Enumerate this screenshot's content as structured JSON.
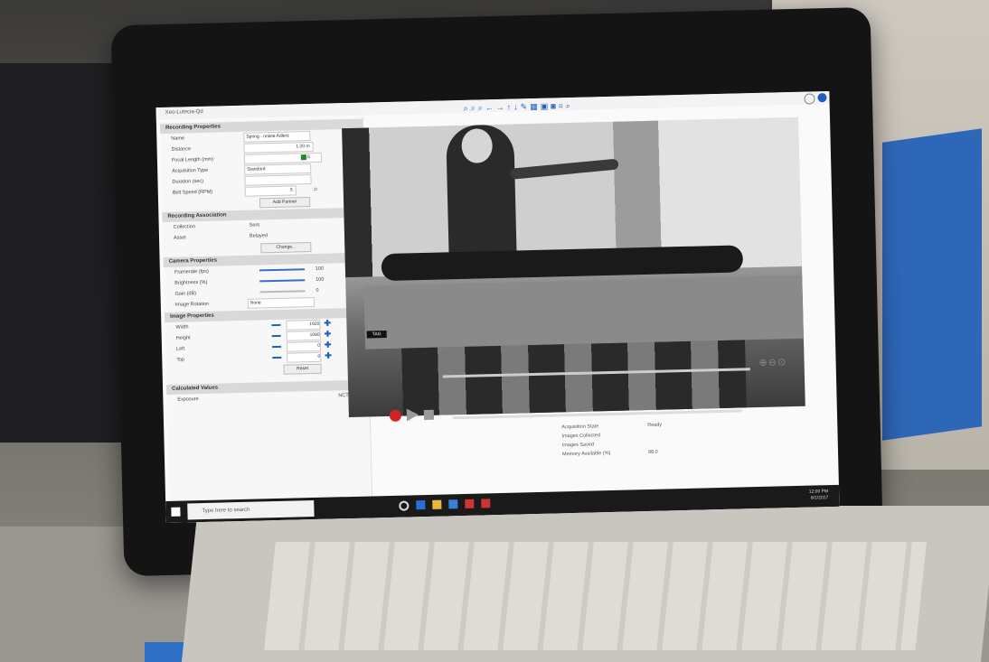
{
  "window": {
    "title": "Xeo-Lutecia-Qd"
  },
  "toolbar_icons": [
    "zoom-in-icon",
    "zoom-out-icon",
    "zoom-fit-icon",
    "arrow-left-icon",
    "arrow-right-icon",
    "arrow-up-icon",
    "arrow-down-icon",
    "pencil-icon",
    "grid-icon",
    "lock-icon",
    "camera-icon",
    "crop-icon",
    "search-icon"
  ],
  "recording_properties": {
    "header": "Recording Properties",
    "rows": [
      {
        "label": "Name",
        "value": "Spring - onsite Adlerz"
      },
      {
        "label": "Distance",
        "value": "1.20  m"
      },
      {
        "label": "Focal Length (mm)",
        "value": "12.5"
      },
      {
        "label": "Acquisition Type",
        "value": "Standard"
      },
      {
        "label": "Duration (sec)",
        "value": ""
      },
      {
        "label": "Belt Speed (RPM)",
        "value": "5"
      }
    ],
    "button": "Add Partner"
  },
  "recording_association": {
    "header": "Recording Association",
    "rows": [
      {
        "label": "Collection",
        "value": "Sent"
      },
      {
        "label": "Asset",
        "value": "Belayed"
      }
    ],
    "button": "Change..."
  },
  "camera_properties": {
    "header": "Camera Properties",
    "rows": [
      {
        "label": "Framerate (fps)",
        "value": "100"
      },
      {
        "label": "Brightness (%)",
        "value": "100"
      },
      {
        "label": "Gain (dB)",
        "value": "0"
      },
      {
        "label": "Image Rotation",
        "value": "None"
      }
    ]
  },
  "image_properties": {
    "header": "Image Properties",
    "rows": [
      {
        "label": "Width",
        "value": "1920"
      },
      {
        "label": "Height",
        "value": "1080"
      },
      {
        "label": "Left",
        "value": "0"
      },
      {
        "label": "Top",
        "value": "0"
      }
    ],
    "reset_label": "Reset"
  },
  "calculated_values": {
    "header": "Calculated Values",
    "rows": [
      {
        "label": "Exposure",
        "value": "NCT"
      }
    ]
  },
  "video": {
    "overlay_tag": "TAG"
  },
  "stats": [
    {
      "label": "Acquisition State",
      "value": "Ready"
    },
    {
      "label": "Images Collected",
      "value": ""
    },
    {
      "label": "Images Saved",
      "value": ""
    },
    {
      "label": "Memory Available (%)",
      "value": "98.0"
    }
  ],
  "taskbar": {
    "search_placeholder": "Type here to search",
    "time": "12:00 PM",
    "date": "8/1/2017"
  },
  "colors": {
    "accent": "#1f5fbf",
    "record": "#d32222"
  }
}
